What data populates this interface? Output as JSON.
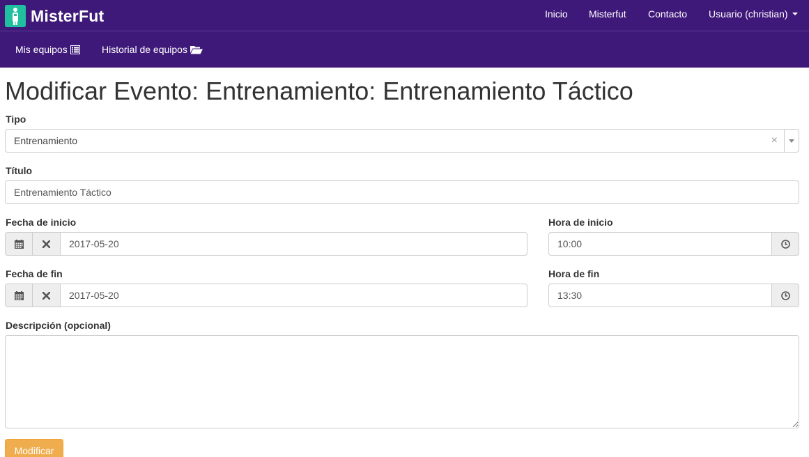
{
  "brand": {
    "name": "MisterFut"
  },
  "nav": {
    "items": [
      {
        "label": "Inicio"
      },
      {
        "label": "Misterfut"
      },
      {
        "label": "Contacto"
      }
    ],
    "user_label": "Usuario (christian)"
  },
  "subnav": {
    "items": [
      {
        "label": "Mis equipos",
        "icon": "list-icon"
      },
      {
        "label": "Historial de equipos",
        "icon": "folder-open-icon"
      }
    ]
  },
  "page": {
    "title": "Modificar Evento: Entrenamiento: Entrenamiento Táctico"
  },
  "form": {
    "tipo": {
      "label": "Tipo",
      "value": "Entrenamiento",
      "clear_symbol": "×"
    },
    "titulo": {
      "label": "Título",
      "value": "Entrenamiento Táctico"
    },
    "fecha_inicio": {
      "label": "Fecha de inicio",
      "value": "2017-05-20"
    },
    "hora_inicio": {
      "label": "Hora de inicio",
      "value": "10:00"
    },
    "fecha_fin": {
      "label": "Fecha de fin",
      "value": "2017-05-20"
    },
    "hora_fin": {
      "label": "Hora de fin",
      "value": "13:30"
    },
    "descripcion": {
      "label": "Descripción (opcional)",
      "value": ""
    },
    "submit_label": "Modificar"
  },
  "colors": {
    "navbar": "#3f197a",
    "brand_logo": "#1fbf9f",
    "submit_button": "#f0ad4e"
  }
}
